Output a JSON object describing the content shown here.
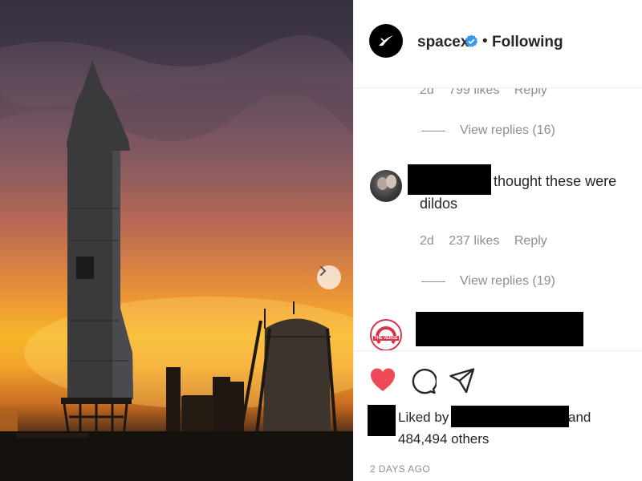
{
  "post": {
    "username": "spacex",
    "follow_separator": "•",
    "follow_status": "Following",
    "verified_color": "#3897f0",
    "photo_alt": ""
  },
  "comments": [
    {
      "age": "2d",
      "likes": "799 likes",
      "reply_label": "Reply",
      "view_replies": "View replies (16)"
    },
    {
      "author": "",
      "text_line1": "thought these were",
      "text_line2": "dildos",
      "age": "2d",
      "likes": "237 likes",
      "reply_label": "Reply",
      "view_replies": "View replies (19)"
    },
    {
      "author": "",
      "avatar_logo": "THE VERGE"
    }
  ],
  "actions": {
    "like_icon": "heart-icon",
    "comment_icon": "comment-icon",
    "share_icon": "share-icon",
    "liked_state_color": "#ed4956"
  },
  "likes": {
    "liked_by_prefix": "Liked by",
    "and_label": "and",
    "others_count": "484,494 others"
  },
  "timestamp": "2 DAYS AGO"
}
